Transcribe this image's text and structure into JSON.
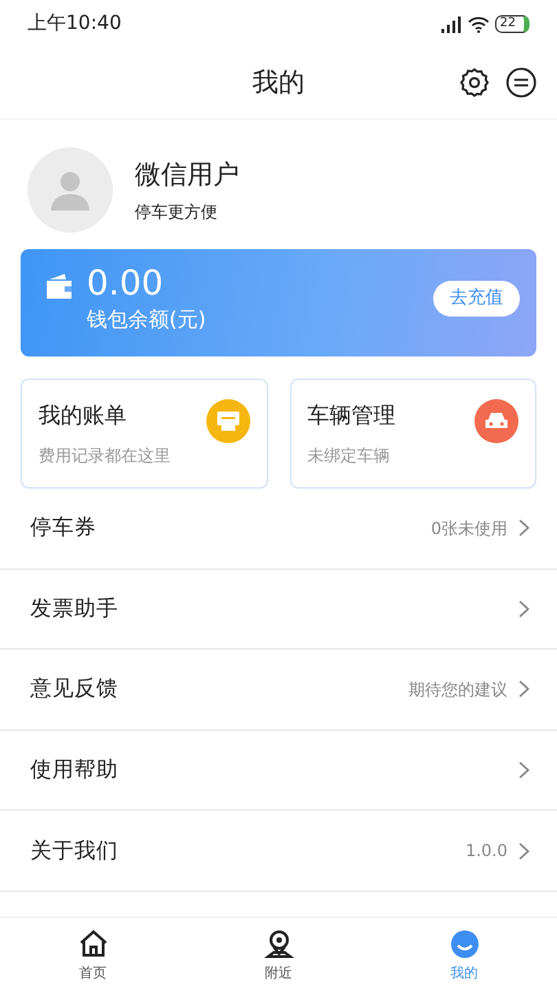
{
  "status_bar": {
    "time": "上午10:40",
    "battery": "22"
  },
  "header": {
    "title": "我的"
  },
  "profile": {
    "name": "微信用户",
    "subtitle": "停车更方便"
  },
  "wallet": {
    "amount": "0.00",
    "label": "钱包余额(元)",
    "button": "去充值"
  },
  "cards": [
    {
      "title": "我的账单",
      "subtitle": "费用记录都在这里",
      "color": "#f5b70f",
      "kind": "bill"
    },
    {
      "title": "车辆管理",
      "subtitle": "未绑定车辆",
      "color": "#f26a4f",
      "kind": "car"
    }
  ],
  "menu": [
    {
      "label": "停车券",
      "value": "0张未使用"
    },
    {
      "label": "发票助手"
    },
    {
      "label": "意见反馈",
      "value": "期待您的建议"
    },
    {
      "label": "使用帮助"
    },
    {
      "label": "关于我们",
      "value": "1.0.0"
    }
  ],
  "tabs": [
    {
      "label": "首页",
      "kind": "home",
      "selected": false
    },
    {
      "label": "附近",
      "kind": "nearby",
      "selected": false
    },
    {
      "label": "我的",
      "kind": "mine",
      "selected": true
    }
  ]
}
